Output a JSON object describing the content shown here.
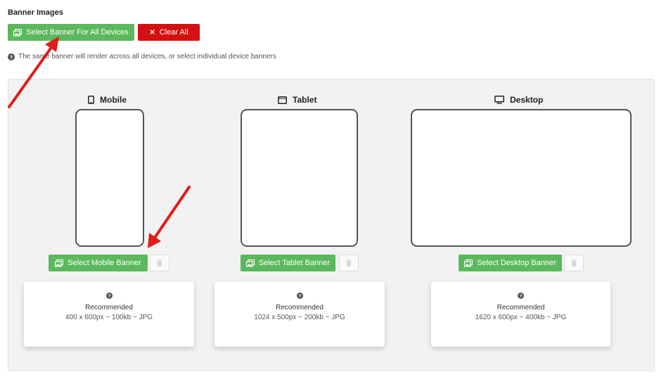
{
  "header": {
    "title": "Banner Images",
    "select_all_label": "Select Banner For All Devices",
    "clear_all_label": "Clear All",
    "note": "The same banner will render across all devices, or select individual device banners"
  },
  "devices": [
    {
      "label": "Mobile",
      "icon": "mobile-icon",
      "button_label": "Select Mobile Banner",
      "recommended_label": "Recommended",
      "spec": "400 x 600px ~ 100kb ~ JPG"
    },
    {
      "label": "Tablet",
      "icon": "tablet-icon",
      "button_label": "Select Tablet Banner",
      "recommended_label": "Recommended",
      "spec": "1024 x 500px ~ 200kb ~ JPG"
    },
    {
      "label": "Desktop",
      "icon": "desktop-icon",
      "button_label": "Select Desktop Banner",
      "recommended_label": "Recommended",
      "spec": "1620 x 600px ~ 400kb ~ JPG"
    }
  ],
  "colors": {
    "green": "#5cb85c",
    "red": "#d41111",
    "arrow": "#e01b1b",
    "panel_bg": "#f2f2f2"
  }
}
